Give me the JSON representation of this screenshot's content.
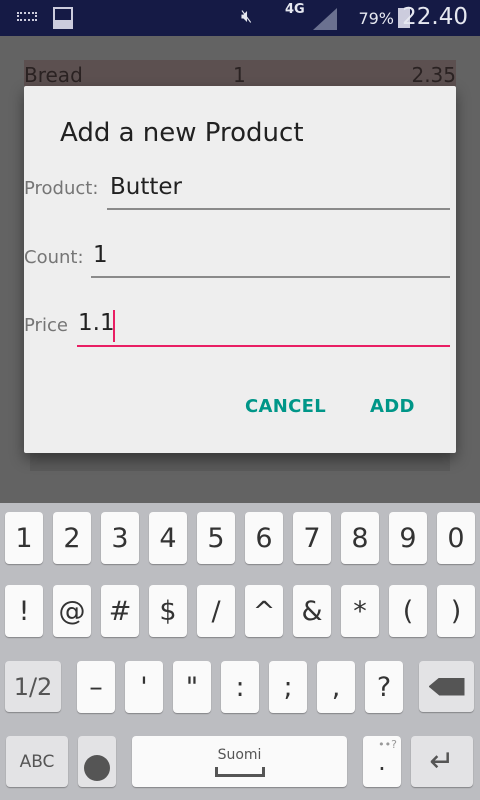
{
  "status_bar": {
    "battery": "79%",
    "time": "22.40",
    "network": "4G",
    "icons": [
      "keyboard-icon",
      "gallery-icon",
      "mute-icon",
      "signal-icon",
      "battery-charging-icon"
    ]
  },
  "list_row": {
    "name": "Bread",
    "count": "1",
    "price": "2.35"
  },
  "dialog": {
    "title": "Add a new Product",
    "product_label": "Product:",
    "product_value": "Butter",
    "count_label": "Count:",
    "count_value": "1",
    "price_label": "Price",
    "price_value": "1.1",
    "cancel": "CANCEL",
    "add": "ADD",
    "accent": "#009688",
    "focus_color": "#e91e63"
  },
  "keyboard": {
    "row1": [
      "1",
      "2",
      "3",
      "4",
      "5",
      "6",
      "7",
      "8",
      "9",
      "0"
    ],
    "row2": [
      "!",
      "@",
      "#",
      "$",
      "/",
      "^",
      "&",
      "*",
      "(",
      ")"
    ],
    "row3": [
      "–",
      "'",
      "\"",
      ":",
      ";",
      ",",
      "?"
    ],
    "shift_label": "1/2",
    "abc_label": "ABC",
    "space_label": "Suomi",
    "period_label": ".",
    "period_hint": "••?"
  }
}
